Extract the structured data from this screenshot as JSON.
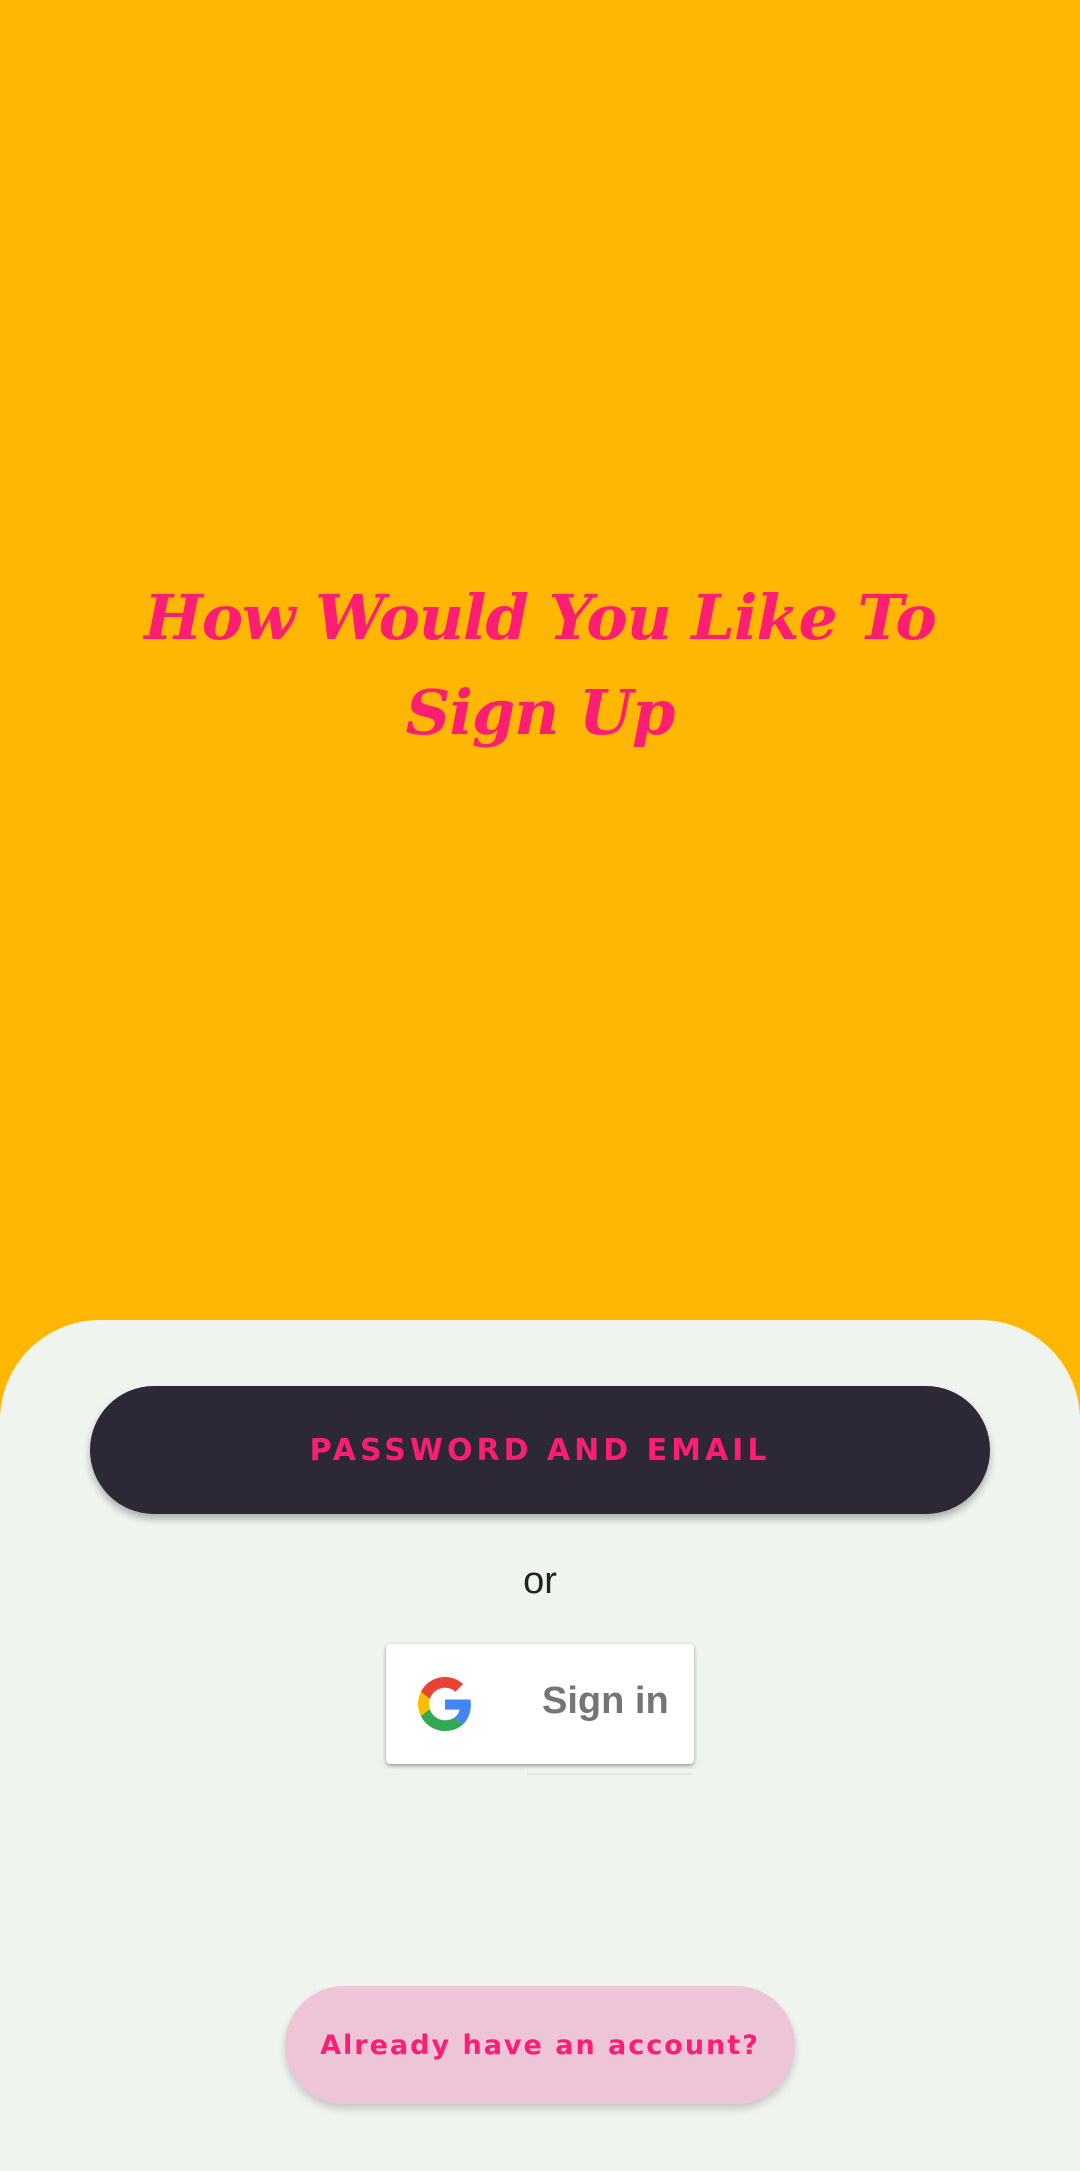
{
  "header": {
    "title": "How Would You Like To Sign Up"
  },
  "auth": {
    "primary_label": "PASSWORD AND EMAIL",
    "divider_label": "or",
    "google_label": "Sign in",
    "google_icon": "google-g-icon"
  },
  "footer": {
    "login_label": "Already have an account?"
  },
  "colors": {
    "background": "#FFB703",
    "accent": "#FB1E72",
    "sheet": "#EFF5EE",
    "primary_button": "#2D2836",
    "secondary_button": "#EDC5D6"
  }
}
